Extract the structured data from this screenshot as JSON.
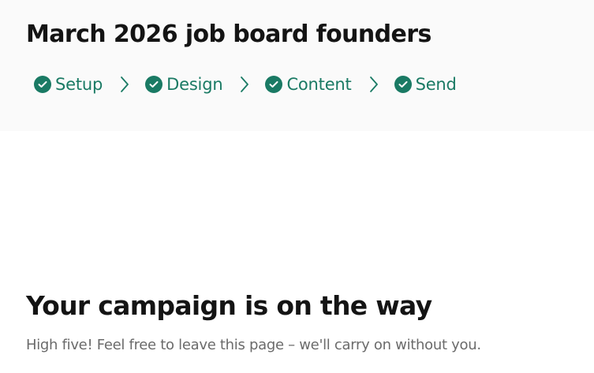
{
  "header": {
    "title": "March 2026 job board founders"
  },
  "steps": [
    {
      "label": "Setup",
      "icon": "check-circle-icon",
      "completed": true
    },
    {
      "label": "Design",
      "icon": "check-circle-icon",
      "completed": true
    },
    {
      "label": "Content",
      "icon": "check-circle-icon",
      "completed": true
    },
    {
      "label": "Send",
      "icon": "check-circle-icon",
      "completed": true
    }
  ],
  "separator_icon": "chevron-right-icon",
  "confirmation": {
    "title": "Your campaign is on the way",
    "message": "High five! Feel free to leave this page – we'll carry on without you."
  },
  "colors": {
    "accent": "#1a7a64",
    "header_bg": "#fafafa",
    "title_text": "#141414",
    "muted_text": "#6b6b6b"
  }
}
